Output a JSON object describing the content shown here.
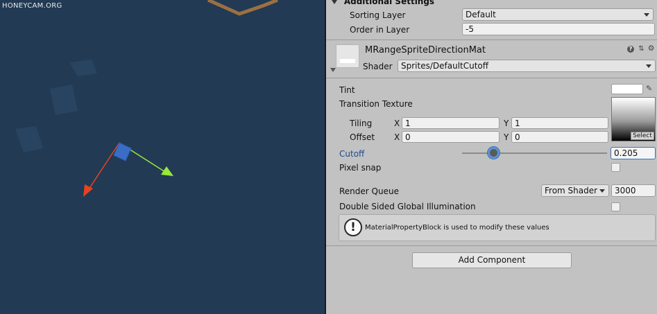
{
  "watermark": "HONEYCAM.ORG",
  "additional_settings": {
    "title": "Additional Settings",
    "sorting_layer_label": "Sorting Layer",
    "sorting_layer_value": "Default",
    "order_in_layer_label": "Order in Layer",
    "order_in_layer_value": "-5"
  },
  "material": {
    "name": "MRangeSpriteDirectionMat",
    "shader_label": "Shader",
    "shader_value": "Sprites/DefaultCutoff"
  },
  "properties": {
    "tint_label": "Tint",
    "tint_color": "#ffffff",
    "transition_texture_label": "Transition Texture",
    "select_label": "Select",
    "tiling_label": "Tiling",
    "tiling_x_axis": "X",
    "tiling_x": "1",
    "tiling_y_axis": "Y",
    "tiling_y": "1",
    "offset_label": "Offset",
    "offset_x_axis": "X",
    "offset_x": "0",
    "offset_y_axis": "Y",
    "offset_y": "0",
    "cutoff_label": "Cutoff",
    "cutoff_value": "0.205",
    "pixel_snap_label": "Pixel snap",
    "render_queue_label": "Render Queue",
    "render_queue_mode": "From Shader",
    "render_queue_value": "3000",
    "dsgi_label": "Double Sided Global Illumination"
  },
  "info_box": {
    "message": "MaterialPropertyBlock is used to modify these values"
  },
  "add_component_label": "Add Component",
  "colors": {
    "scene_bg": "#223a54",
    "inspector_bg": "#c2c2c2",
    "cutoff_label_color": "#1b4a8c",
    "gizmo_red": "#e8421e",
    "gizmo_green": "#9ae83a",
    "gizmo_blue": "#3a6ec6"
  }
}
